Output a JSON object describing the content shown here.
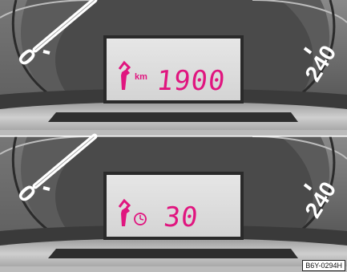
{
  "panels": [
    {
      "scale_min": "0",
      "scale_max": "240",
      "display": {
        "icon": "wrench-icon",
        "unit": "km",
        "value": "1900",
        "color": "#e0157f"
      }
    },
    {
      "scale_min": "0",
      "scale_max": "240",
      "display": {
        "icon": "wrench-icon",
        "unit_icon": "clock-icon",
        "value": "30",
        "color": "#e0157f"
      }
    }
  ],
  "reference_code": "B6Y-0294H"
}
